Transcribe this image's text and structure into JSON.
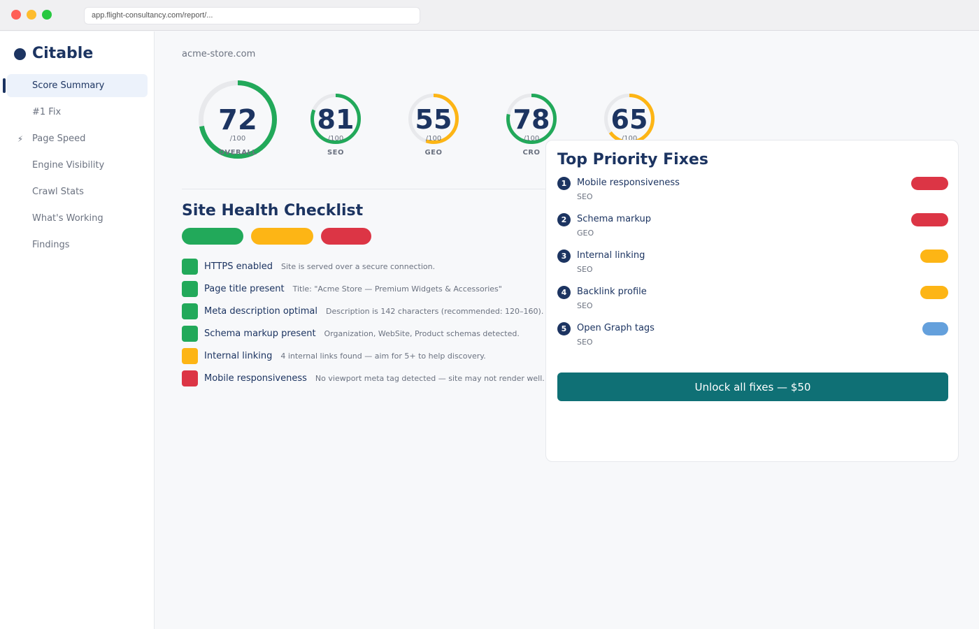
{
  "browser": {
    "url": "app.flight-consultancy.com/report/..."
  },
  "sidebar": {
    "logo": "Citable",
    "items": [
      {
        "label": "Score Summary",
        "icon": "chart-icon",
        "glyph": "",
        "active": true
      },
      {
        "label": "#1 Fix",
        "icon": "wrench-icon",
        "glyph": "",
        "active": false
      },
      {
        "label": "Page Speed",
        "icon": "lightning-icon",
        "glyph": "⚡",
        "active": false
      },
      {
        "label": "Engine Visibility",
        "icon": "eye-icon",
        "glyph": "",
        "active": false
      },
      {
        "label": "Crawl Stats",
        "icon": "spider-icon",
        "glyph": "",
        "active": false
      },
      {
        "label": "What's Working",
        "icon": "check-icon",
        "glyph": "",
        "active": false
      },
      {
        "label": "Findings",
        "icon": "search-icon",
        "glyph": "",
        "active": false
      }
    ]
  },
  "main": {
    "domain": "acme-store.com",
    "scores": [
      {
        "value": "72",
        "max": "/100",
        "label": "OVERALL",
        "fraction": 0.72,
        "color": "#22a95a"
      },
      {
        "value": "81",
        "max": "/100",
        "label": "SEO",
        "fraction": 0.81,
        "color": "#22a95a"
      },
      {
        "value": "55",
        "max": "/100",
        "label": "GEO",
        "fraction": 0.55,
        "color": "#fdb515"
      },
      {
        "value": "78",
        "max": "/100",
        "label": "CRO",
        "fraction": 0.78,
        "color": "#22a95a"
      },
      {
        "value": "65",
        "max": "/100",
        "label": "",
        "fraction": 0.65,
        "color": "#fdb515"
      }
    ],
    "checklist_title": "Site Health Checklist",
    "legend": [
      {
        "status": "pass",
        "color": "#22a95a"
      },
      {
        "status": "warn",
        "color": "#fdb515"
      },
      {
        "status": "fail",
        "color": "#dc3545"
      }
    ],
    "checks": [
      {
        "name": "HTTPS enabled",
        "desc": "Site is served over a secure connection.",
        "status": "pass"
      },
      {
        "name": "Page title present",
        "desc": "Title: \"Acme Store — Premium Widgets & Accessories\"",
        "status": "pass"
      },
      {
        "name": "Meta description optimal",
        "desc": "Description is 142 characters (recommended: 120–160).",
        "status": "pass"
      },
      {
        "name": "Schema markup present",
        "desc": "Organization, WebSite, Product schemas detected.",
        "status": "pass"
      },
      {
        "name": "Internal linking",
        "desc": "4 internal links found — aim for 5+ to help discovery.",
        "status": "warn"
      },
      {
        "name": "Mobile responsiveness",
        "desc": "No viewport meta tag detected — site may not render well.",
        "status": "fail"
      }
    ]
  },
  "priority": {
    "title": "Top Priority Fixes",
    "fixes": [
      {
        "num": "1",
        "name": "Mobile responsiveness",
        "category": "SEO",
        "severity": "high"
      },
      {
        "num": "2",
        "name": "Schema markup",
        "category": "GEO",
        "severity": "high"
      },
      {
        "num": "3",
        "name": "Internal linking",
        "category": "SEO",
        "severity": "medium"
      },
      {
        "num": "4",
        "name": "Backlink profile",
        "category": "SEO",
        "severity": "medium"
      },
      {
        "num": "5",
        "name": "Open Graph tags",
        "category": "SEO",
        "severity": "low"
      }
    ],
    "unlock_label": "Unlock all fixes — $50"
  },
  "colors": {
    "pass": "#22a95a",
    "warn": "#fdb515",
    "fail": "#dc3545",
    "high": "#dc3545",
    "medium": "#fdb515",
    "low": "#64a0dc",
    "primary": "#1c3461",
    "accent": "#0f7075",
    "track": "#e8e9ec"
  }
}
